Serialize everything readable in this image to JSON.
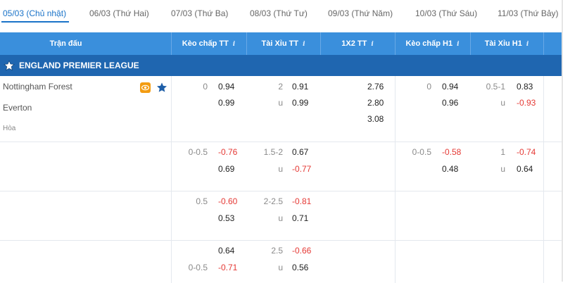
{
  "date_tabs": [
    {
      "label": "05/03 (Chủ nhật)",
      "active": true
    },
    {
      "label": "06/03 (Thứ Hai)",
      "active": false
    },
    {
      "label": "07/03 (Thứ Ba)",
      "active": false
    },
    {
      "label": "08/03 (Thứ Tư)",
      "active": false
    },
    {
      "label": "09/03 (Thứ Năm)",
      "active": false
    },
    {
      "label": "10/03 (Thứ Sáu)",
      "active": false
    },
    {
      "label": "11/03 (Thứ Bảy)",
      "active": false
    }
  ],
  "columns": {
    "match": "Trận đấu",
    "handicap_ft": "Kèo chấp TT",
    "ou_ft": "Tài Xỉu TT",
    "x12_ft": "1X2 TT",
    "handicap_h1": "Kèo chấp H1",
    "ou_h1": "Tài Xỉu H1",
    "info_glyph": "i"
  },
  "league": {
    "name": "ENGLAND PREMIER LEAGUE"
  },
  "match": {
    "home": "Nottingham Forest",
    "away": "Everton",
    "draw": "Hòa"
  },
  "rows": [
    {
      "hc_line": "0",
      "hc_home": "0.94",
      "hc_away": "0.99",
      "ou_line": "2",
      "ou_over": "0.91",
      "ou_u": "u",
      "ou_under": "0.99",
      "x_home": "2.76",
      "x_away": "2.80",
      "x_draw": "3.08",
      "h1hc_line": "0",
      "h1hc_home": "0.94",
      "h1hc_away": "0.96",
      "h1ou_line": "0.5-1",
      "h1ou_over": "0.83",
      "h1ou_u": "u",
      "h1ou_under": "-0.93"
    },
    {
      "hc_line": "0-0.5",
      "hc_home": "-0.76",
      "hc_away": "0.69",
      "ou_line": "1.5-2",
      "ou_over": "0.67",
      "ou_u": "u",
      "ou_under": "-0.77",
      "h1hc_line": "0-0.5",
      "h1hc_home": "-0.58",
      "h1hc_away": "0.48",
      "h1ou_line": "1",
      "h1ou_over": "-0.74",
      "h1ou_u": "u",
      "h1ou_under": "0.64"
    },
    {
      "hc_line": "0.5",
      "hc_home": "-0.60",
      "hc_away": "0.53",
      "ou_line": "2-2.5",
      "ou_over": "-0.81",
      "ou_u": "u",
      "ou_under": "0.71"
    },
    {
      "hc_home": "0.64",
      "hc_line2": "0-0.5",
      "hc_away": "-0.71",
      "ou_line": "2.5",
      "ou_over": "-0.66",
      "ou_u": "u",
      "ou_under": "0.56"
    }
  ],
  "colors": {
    "header_bg": "#3a8fdc",
    "league_bg": "#1f66b0",
    "active_tab": "#1a73c8",
    "negative": "#e53935",
    "live_icon": "#f39c12"
  }
}
